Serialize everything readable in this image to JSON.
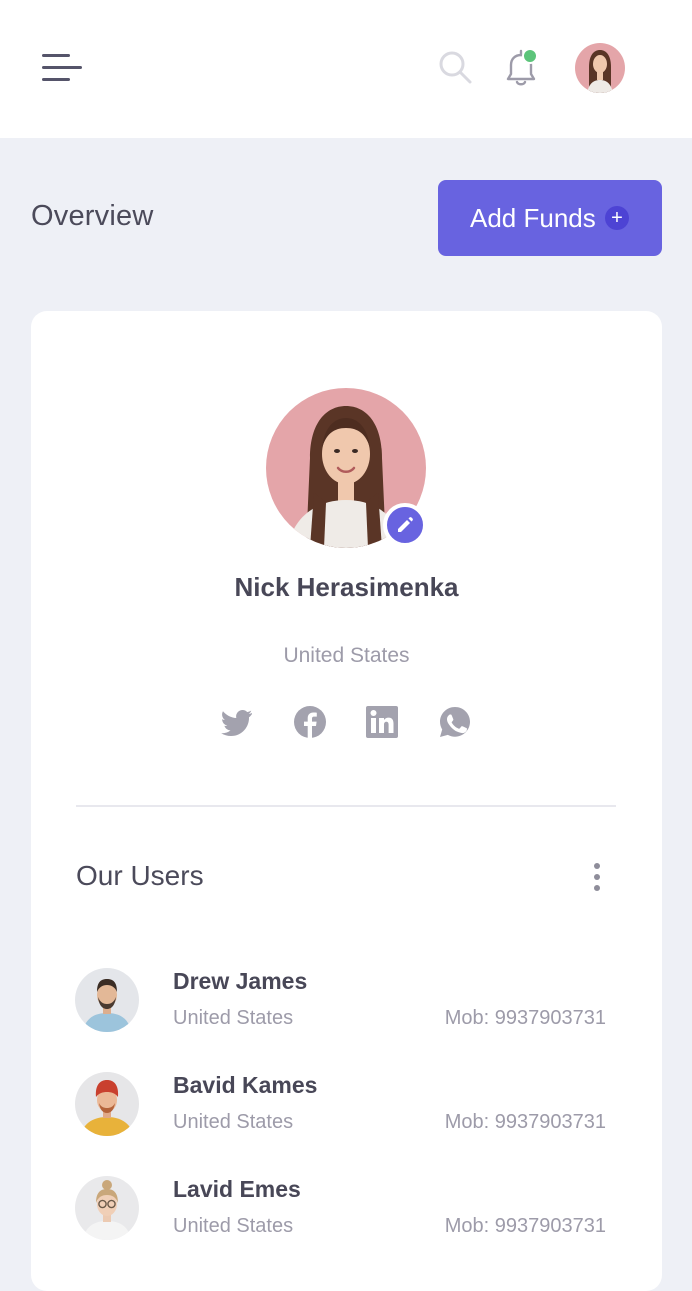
{
  "header": {
    "menu_icon": "hamburger-icon",
    "search_icon": "search-icon",
    "notification_icon": "bell-icon",
    "notification_dot_color": "#5cc47a",
    "avatar": "user-avatar"
  },
  "overview": {
    "title": "Overview",
    "add_funds_label": "Add Funds",
    "add_funds_icon": "+",
    "accent_color": "#6863e0"
  },
  "profile": {
    "name": "Nick Herasimenka",
    "location": "United States",
    "edit_icon": "pencil-icon",
    "social": [
      "twitter-icon",
      "facebook-icon",
      "linkedin-icon",
      "whatsapp-icon"
    ]
  },
  "users": {
    "title": "Our Users",
    "more_icon": "more-vertical-icon",
    "items": [
      {
        "name": "Drew James",
        "location": "United States",
        "mobile": "Mob: 9937903731"
      },
      {
        "name": "Bavid Kames",
        "location": "United States",
        "mobile": "Mob: 9937903731"
      },
      {
        "name": "Lavid Emes",
        "location": "United States",
        "mobile": "Mob: 9937903731"
      }
    ]
  }
}
